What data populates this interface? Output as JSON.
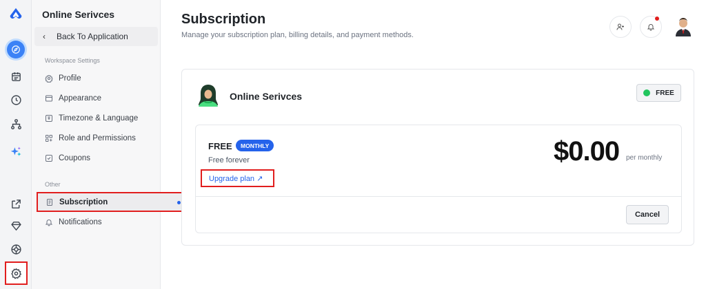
{
  "rail": {
    "logo": "app-logo-icon",
    "top_items": [
      "compass-icon",
      "calendar-icon",
      "clock-icon",
      "org-chart-icon",
      "sparkles-icon"
    ],
    "bottom_items": [
      "external-link-icon",
      "diamond-icon",
      "help-lifebuoy-icon",
      "settings-icon"
    ]
  },
  "sidebar": {
    "title": "Online Serivces",
    "back_label": "Back To Application",
    "workspace_section": "Workspace Settings",
    "workspace_items": [
      {
        "label": "Profile",
        "icon": "gear-icon"
      },
      {
        "label": "Appearance",
        "icon": "window-icon"
      },
      {
        "label": "Timezone & Language",
        "icon": "language-icon"
      },
      {
        "label": "Role and Permissions",
        "icon": "role-icon"
      },
      {
        "label": "Coupons",
        "icon": "coupon-icon"
      }
    ],
    "other_section": "Other",
    "other_items": [
      {
        "label": "Subscription",
        "icon": "document-icon",
        "selected": true
      },
      {
        "label": "Notifications",
        "icon": "bell-icon"
      }
    ]
  },
  "header": {
    "title": "Subscription",
    "subtitle": "Manage your subscription plan, billing details, and payment methods."
  },
  "org": {
    "name": "Online Serivces",
    "status": "FREE"
  },
  "plan": {
    "name": "FREE",
    "cycle": "MONTHLY",
    "description": "Free forever",
    "upgrade_label": "Upgrade plan ↗",
    "price": "$0.00",
    "period": "per monthly",
    "cancel_label": "Cancel"
  },
  "colors": {
    "accent": "#2563eb",
    "status_green": "#22c55e",
    "highlight_red": "#e11d1d"
  }
}
